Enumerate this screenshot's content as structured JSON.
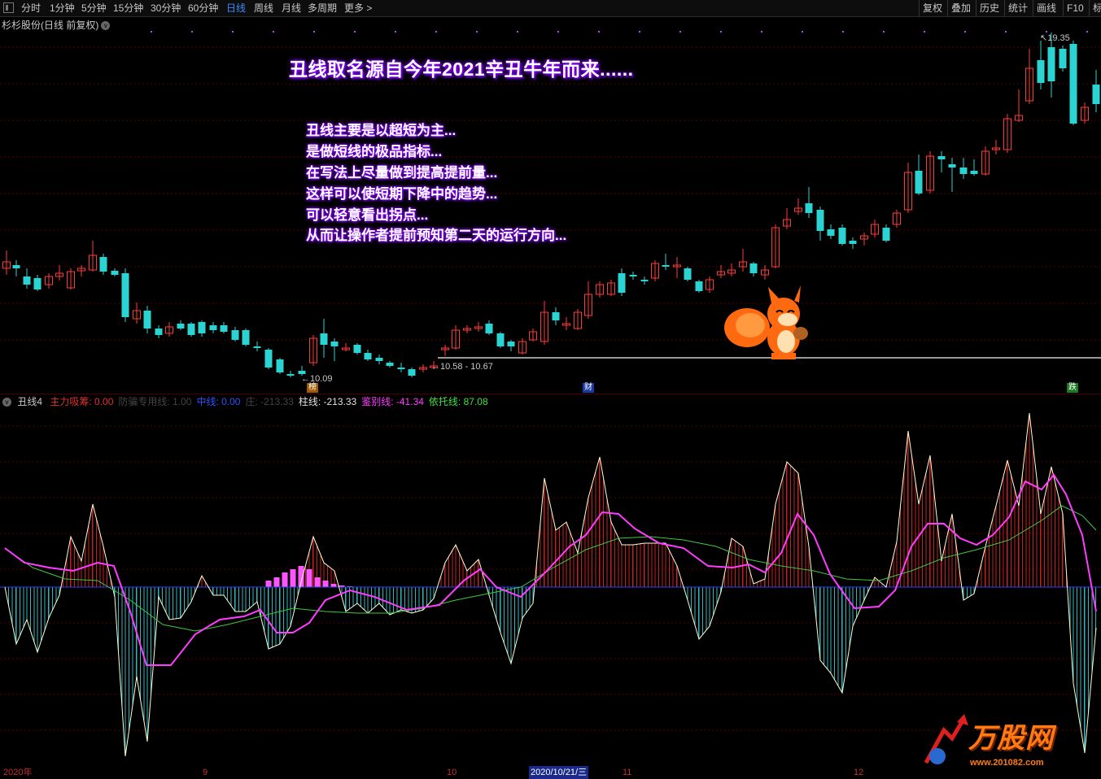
{
  "toolbar": {
    "periods": [
      "分时",
      "1分钟",
      "5分钟",
      "15分钟",
      "30分钟",
      "60分钟",
      "日线",
      "周线",
      "月线",
      "多周期",
      "更多 >"
    ],
    "active_period": "日线",
    "right_buttons": [
      "复权",
      "叠加",
      "历史",
      "统计",
      "画线",
      "F10",
      "标"
    ]
  },
  "stock_title": "杉杉股份(日线 前复权)",
  "annotations": {
    "headline": "丑线取名源自今年2021辛丑牛年而来......",
    "lines": [
      "丑线主要是以超短为主...",
      "是做短线的极品指标...",
      "在写法上尽量做到提高提前量...",
      "这样可以使短期下降中的趋势...",
      "可以轻意看出拐点...",
      "从而让操作者提前预知第二天的运行方向..."
    ]
  },
  "price_labels": {
    "high": "19.35",
    "low": "10.09",
    "range": "10.58 - 10.67"
  },
  "event_flags": [
    "榜",
    "财",
    "跌"
  ],
  "indicator": {
    "name": "丑线4",
    "values": [
      {
        "label": "主力吸筹",
        "value": "0.00",
        "color": "#e03030"
      },
      {
        "label": "防骗专用线",
        "value": "1.00",
        "color": "#444444"
      },
      {
        "label": "中线",
        "value": "0.00",
        "color": "#3050ff"
      },
      {
        "label": "庄",
        "value": "-213.33",
        "color": "#444444"
      },
      {
        "label": "柱线",
        "value": "-213.33",
        "color": "#e0e0e0"
      },
      {
        "label": "鉴别线",
        "value": "-41.34",
        "color": "#ff3cff"
      },
      {
        "label": "依托线",
        "value": "87.08",
        "color": "#40e040"
      }
    ]
  },
  "date_axis": [
    {
      "label": "2020年"
    },
    {
      "label": "9"
    },
    {
      "label": "10"
    },
    {
      "label": "2020/10/21/三",
      "highlight": true
    },
    {
      "label": "11"
    },
    {
      "label": "12"
    }
  ],
  "watermark": {
    "text": "万股网",
    "url": "www.201082.com"
  },
  "colors": {
    "up": "#ff3a3a",
    "down": "#2cd3d3",
    "pink": "#ff3cff",
    "green": "#40c840",
    "white": "#ffffe0"
  }
}
